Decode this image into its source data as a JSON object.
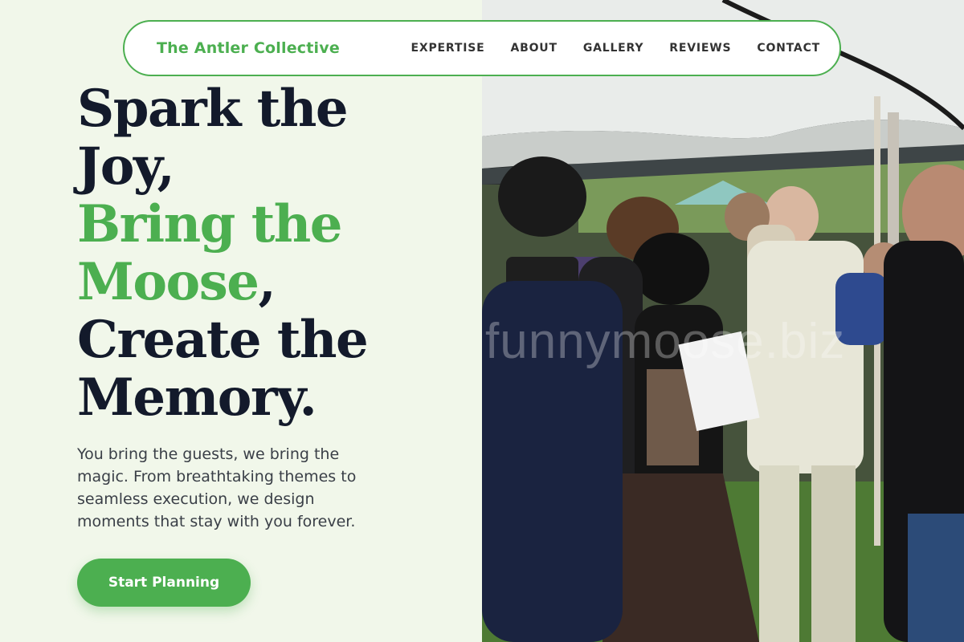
{
  "nav": {
    "brand": "The Antler Collective",
    "links": [
      "EXPERTISE",
      "ABOUT",
      "GALLERY",
      "REVIEWS",
      "CONTACT"
    ]
  },
  "hero": {
    "headline_line1": "Spark the",
    "headline_line2": "Joy,",
    "headline_accent1": "Bring the",
    "headline_accent2": "Moose",
    "headline_comma": ",",
    "headline_line5": "Create the",
    "headline_line6": "Memory.",
    "subtext": "You bring the guests, we bring the magic. From breathtaking themes to seamless execution, we design moments that stay with you forever.",
    "cta_label": "Start Planning"
  },
  "photo": {
    "watermark": "funnymoose.biz"
  },
  "colors": {
    "accent": "#4caf50",
    "headline": "#131a2b",
    "left_background": "#f1f7ea"
  }
}
